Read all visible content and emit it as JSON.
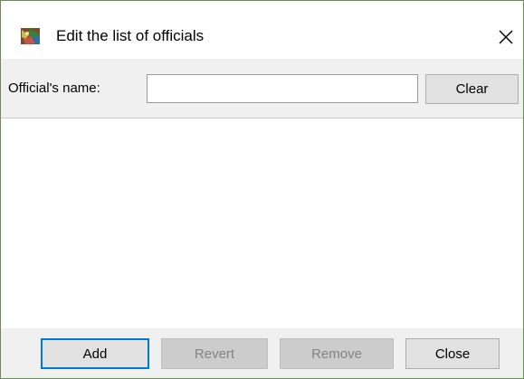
{
  "window": {
    "title": "Edit the list of officials",
    "icon": "officials-app-icon",
    "close_glyph": "✕"
  },
  "form": {
    "name_label": "Official's name:",
    "name_value": "",
    "clear_label": "Clear"
  },
  "list": {
    "items": []
  },
  "buttons": {
    "add_label": "Add",
    "revert_label": "Revert",
    "remove_label": "Remove",
    "close_label": "Close"
  },
  "colors": {
    "accent": "#0078d7",
    "disabled_bg": "#cccccc",
    "disabled_text": "#838383"
  }
}
